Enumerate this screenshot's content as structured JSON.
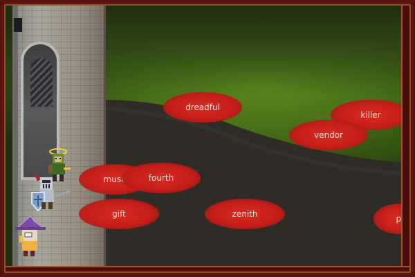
{
  "words": [
    {
      "id": "dreadful",
      "text": "dreadful"
    },
    {
      "id": "killer",
      "text": "killer"
    },
    {
      "id": "vendor",
      "text": "vendor"
    },
    {
      "id": "muse",
      "text": "muse"
    },
    {
      "id": "fourth",
      "text": "fourth"
    },
    {
      "id": "gift",
      "text": "gift"
    },
    {
      "id": "zenith",
      "text": "zenith"
    },
    {
      "id": "partial",
      "text": "pl"
    }
  ],
  "colors": {
    "bubble": "#c61f1a",
    "grass": "#4a7018",
    "road": "#2e2a26",
    "frame": "#5a1410"
  },
  "characters": [
    {
      "name": "green-archer-hero-icon"
    },
    {
      "name": "knight-with-shield-icon"
    },
    {
      "name": "purple-wizard-icon"
    }
  ]
}
